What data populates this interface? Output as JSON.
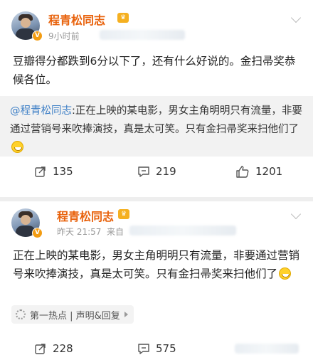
{
  "post1": {
    "author": "程青松同志",
    "badge_glyph": "V",
    "time": "9小时前",
    "text": "豆瓣得分都跌到6分以下了，还有什么好说的。金扫帚奖恭候各位。",
    "quote": {
      "mention": "@程青松同志",
      "text": ":正在上映的某电影，男女主角明明只有流量，非要通过营销号来吹捧演技，真是太可笑。只有金扫帚奖来扫他们了"
    },
    "reposts": "135",
    "comments": "219",
    "likes": "1201"
  },
  "post2": {
    "author": "程青松同志",
    "badge_glyph": "V",
    "time": "昨天 21:57",
    "source_prefix": "来自",
    "text": "正在上映的某电影，男女主角明明只有流量，非要通过营销号来吹捧演技，真是太可笑。只有金扫帚奖来扫他们了",
    "topic": "第一热点 | 声明&回复",
    "reposts": "228",
    "comments": "575"
  },
  "icons": [
    "avatar",
    "verified-badge-icon",
    "crown-badge-icon",
    "chevron-down-icon",
    "repost-icon",
    "comment-icon",
    "like-icon",
    "grin-emoji-icon",
    "hot-topic-icon",
    "arrow-right-icon"
  ],
  "colors": {
    "author": "#e8620c",
    "mention": "#3d7fc6",
    "badge": "#f39c12",
    "muted": "#999999",
    "quote_bg": "#f2f2f2",
    "divider": "#eeeeee"
  }
}
